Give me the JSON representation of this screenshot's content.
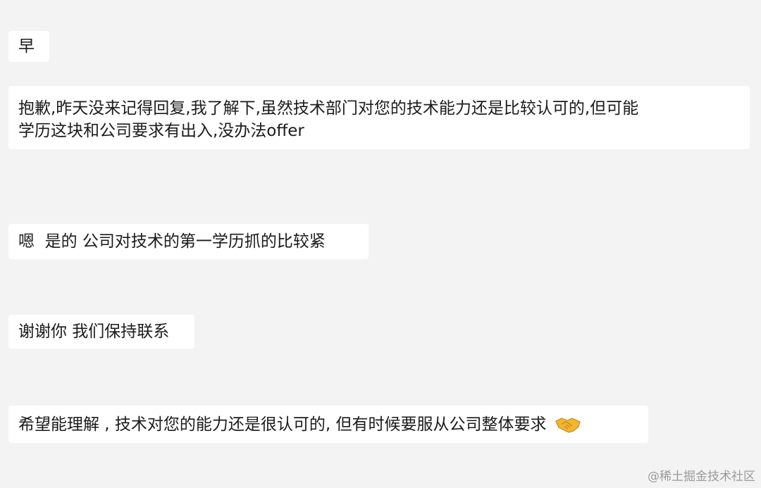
{
  "messages": [
    {
      "text": "早"
    },
    {
      "lines": [
        "抱歉,昨天没来记得回复,我了解下,虽然技术部门对您的技术能力还是比较认可的,但可能",
        "学历这块和公司要求有出入,没办法offer"
      ]
    },
    {
      "text": "嗯  是的 公司对技术的第一学历抓的比较紧"
    },
    {
      "text": "谢谢你 我们保持联系"
    },
    {
      "text": "希望能理解 , 技术对您的能力还是很认可的, 但有时候要服从公司整体要求",
      "emoji": "handshake-emoji"
    }
  ],
  "watermark": "@稀土掘金技术社区",
  "colors": {
    "background": "#f3f3f3",
    "bubble": "#ffffff",
    "text": "#1b1b1b",
    "watermark": "#9a9a9a",
    "emoji": "#f2b632"
  }
}
